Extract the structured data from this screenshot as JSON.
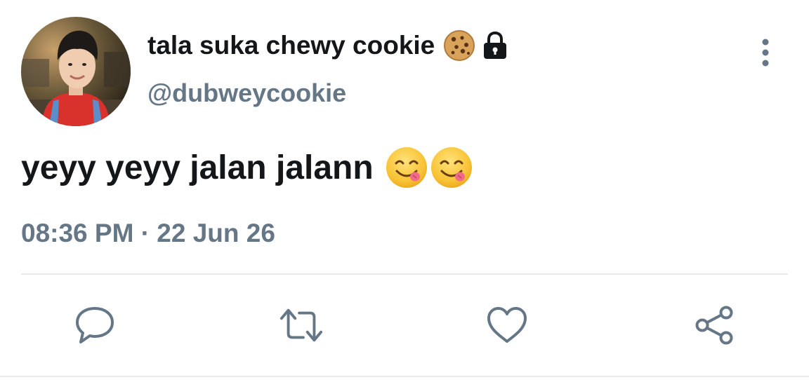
{
  "tweet": {
    "author": {
      "display_name": "tala suka chewy cookie",
      "name_emoji": "cookie-emoji",
      "protected_icon": "lock-icon",
      "handle": "@dubweycookie"
    },
    "text": "yeyy yeyy jalan jalann",
    "text_emojis": [
      "face-savoring-food-emoji",
      "face-savoring-food-emoji"
    ],
    "timestamp": "08:36 PM · 22 Jun 26",
    "actions": {
      "reply_icon": "reply-icon",
      "retweet_icon": "retweet-icon",
      "like_icon": "heart-icon",
      "share_icon": "share-icon"
    },
    "menu_icon": "more-options-icon"
  },
  "colors": {
    "text_primary": "#14171a",
    "text_secondary": "#657786",
    "divider": "#e6ecf0"
  }
}
